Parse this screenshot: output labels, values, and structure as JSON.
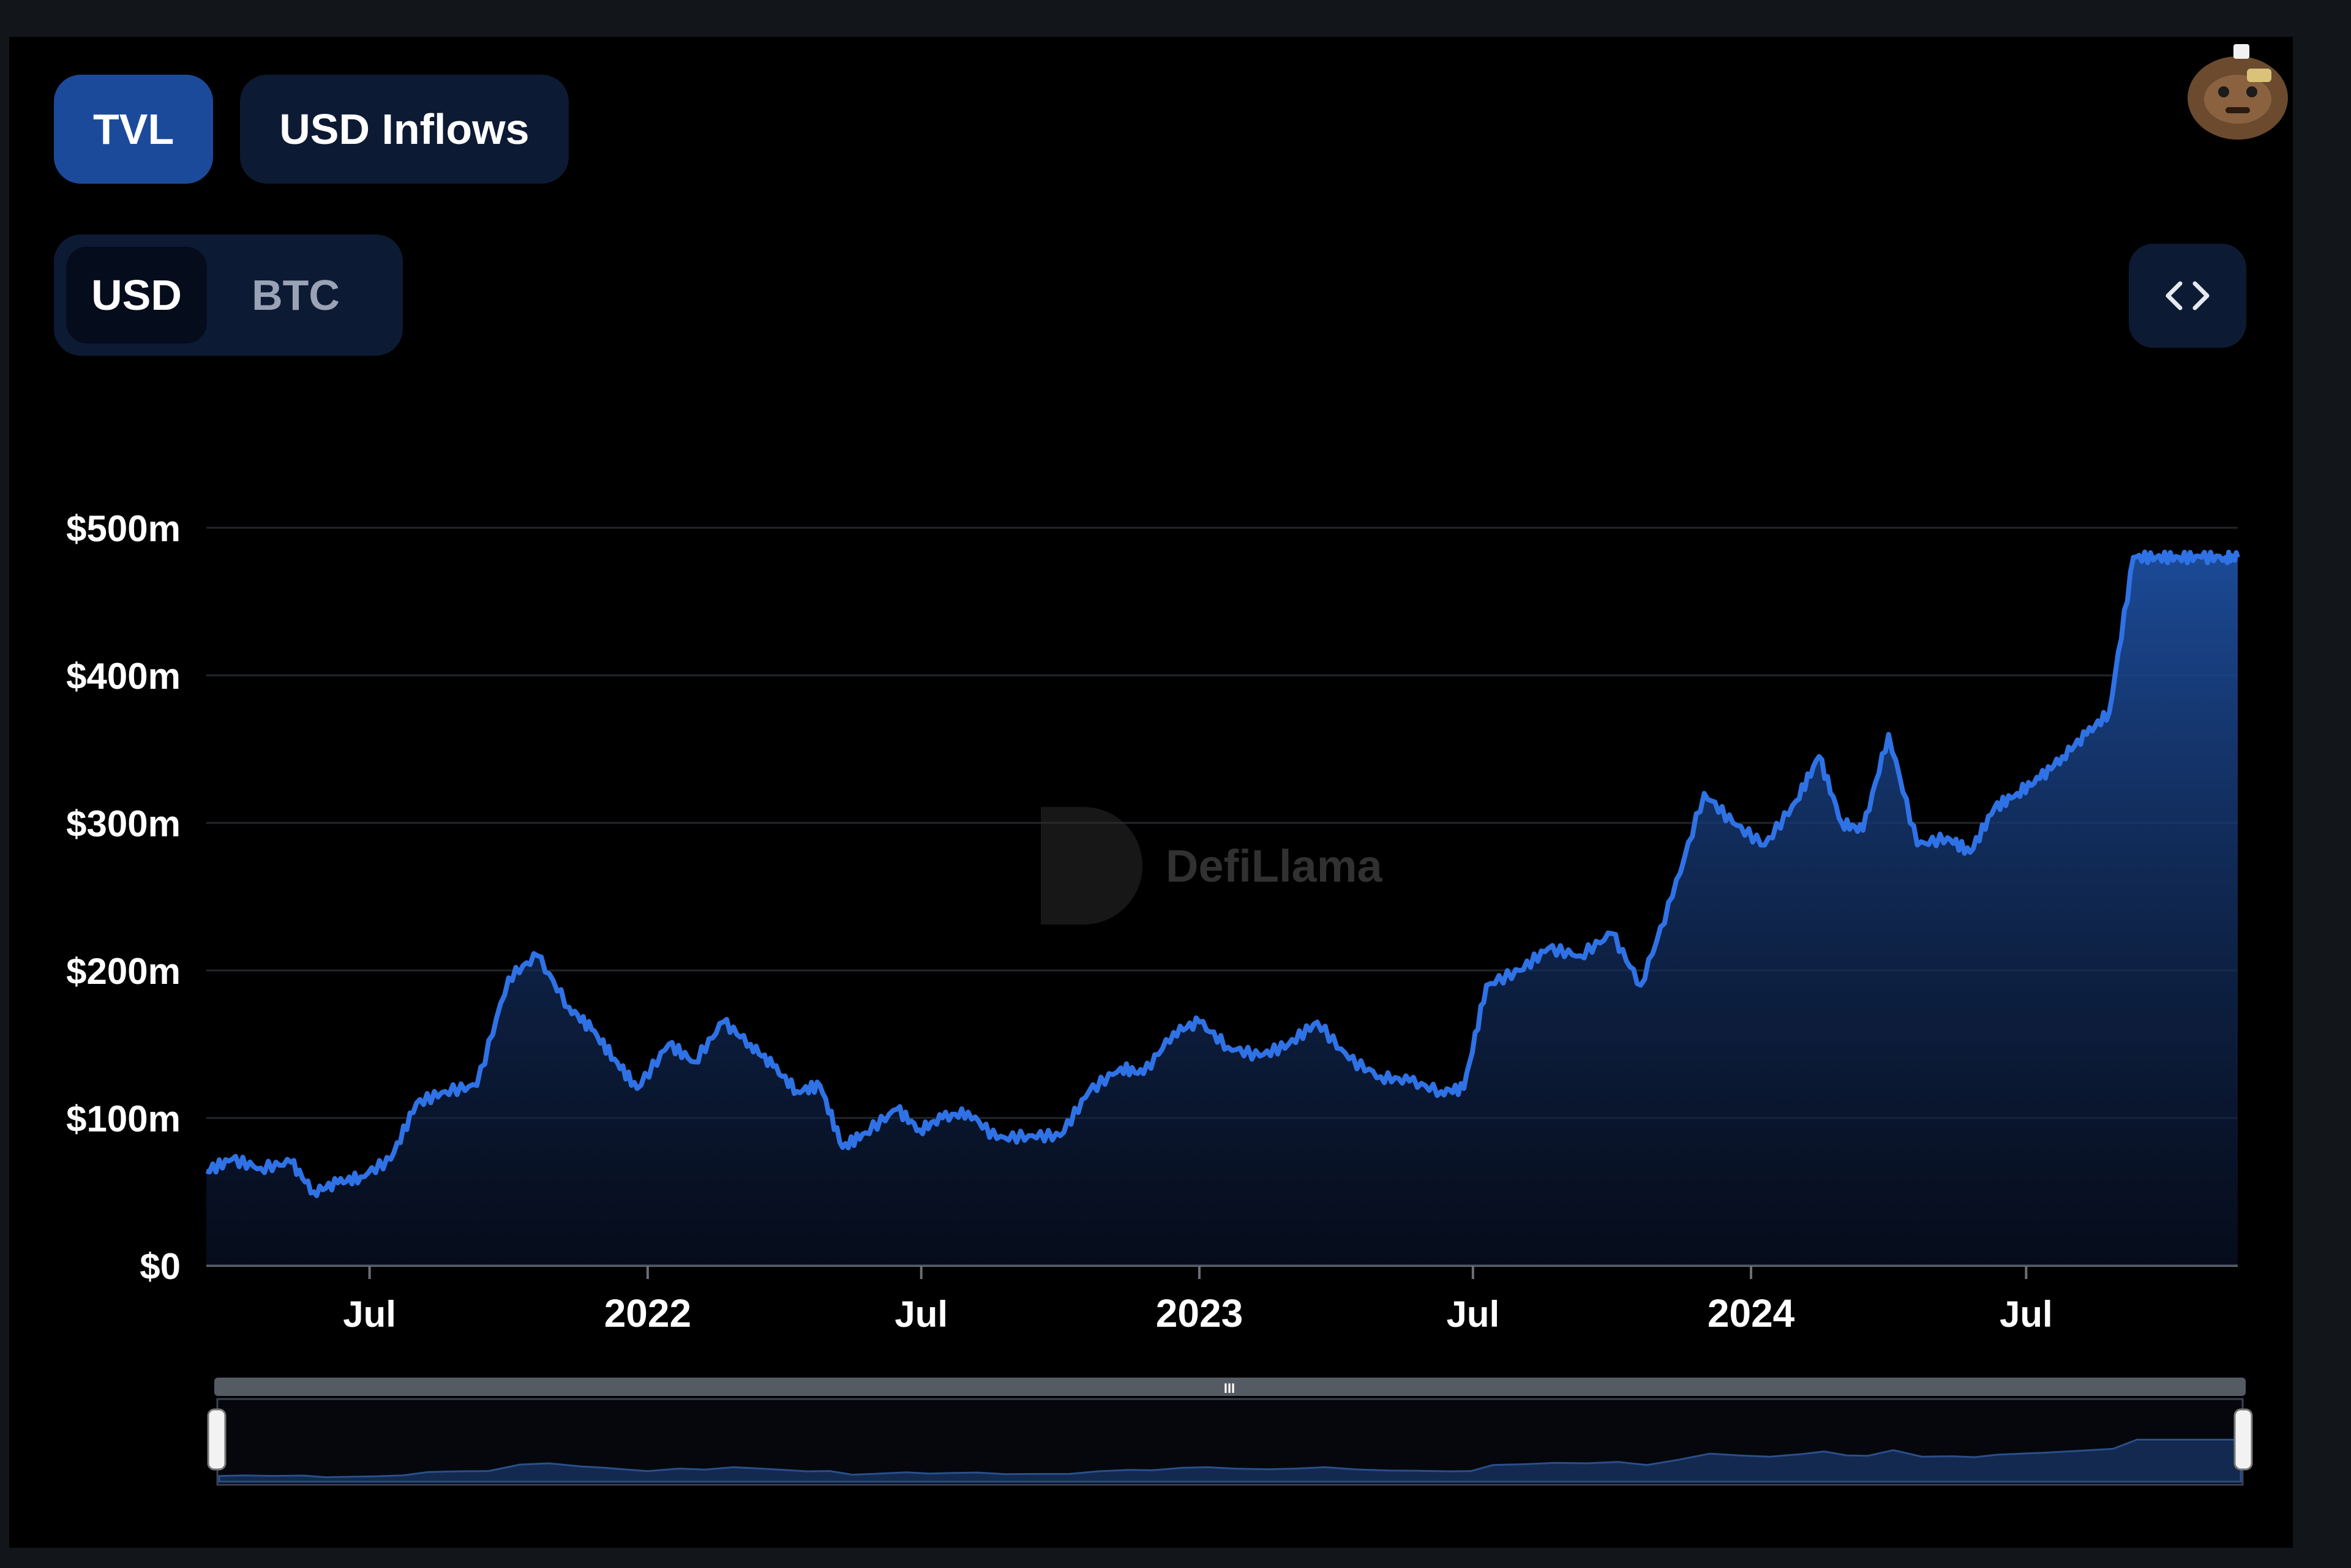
{
  "tabs": [
    {
      "label": "TVL",
      "active": true
    },
    {
      "label": "USD Inflows",
      "active": false
    }
  ],
  "denomination": {
    "options": [
      "USD",
      "BTC"
    ],
    "selected": "USD"
  },
  "icons": {
    "embed": "code-brackets-icon",
    "avatar": "llama-avatar-icon"
  },
  "watermark": "DefiLlama",
  "colors": {
    "line": "#2f72e6",
    "accent": "#1c4a9b",
    "background": "#000000"
  },
  "chart_data": {
    "type": "area",
    "title": "",
    "xlabel": "",
    "ylabel": "",
    "y_ticks": [
      "$0",
      "$100m",
      "$200m",
      "$300m",
      "$400m",
      "$500m"
    ],
    "ylim": [
      0,
      500
    ],
    "y_unit": "$m",
    "x_ticks": [
      {
        "label": "Jul",
        "date": "2021-07-01",
        "bold": false
      },
      {
        "label": "2022",
        "date": "2022-01-01",
        "bold": true
      },
      {
        "label": "Jul",
        "date": "2022-07-01",
        "bold": false
      },
      {
        "label": "2023",
        "date": "2023-01-01",
        "bold": true
      },
      {
        "label": "Jul",
        "date": "2023-07-01",
        "bold": false
      },
      {
        "label": "2024",
        "date": "2024-01-01",
        "bold": true
      },
      {
        "label": "Jul",
        "date": "2024-07-01",
        "bold": false
      }
    ],
    "grid": true,
    "legend": "none",
    "series": [
      {
        "x": [
          "2021-03-15",
          "2021-04-01",
          "2021-04-20",
          "2021-05-10",
          "2021-05-25",
          "2021-06-10",
          "2021-06-25",
          "2021-07-15",
          "2021-08-01",
          "2021-08-20",
          "2021-09-10",
          "2021-10-01",
          "2021-10-20",
          "2021-11-10",
          "2021-11-25",
          "2021-12-10",
          "2021-12-25",
          "2022-01-15",
          "2022-02-01",
          "2022-02-20",
          "2022-03-10",
          "2022-03-25",
          "2022-04-10",
          "2022-04-25",
          "2022-05-10",
          "2022-05-25",
          "2022-06-15",
          "2022-06-30",
          "2022-07-15",
          "2022-08-01",
          "2022-08-20",
          "2022-09-10",
          "2022-10-01",
          "2022-10-20",
          "2022-11-10",
          "2022-11-25",
          "2022-12-15",
          "2023-01-01",
          "2023-01-20",
          "2023-02-10",
          "2023-03-01",
          "2023-03-20",
          "2023-04-10",
          "2023-05-01",
          "2023-05-20",
          "2023-06-10",
          "2023-06-25",
          "2023-07-10",
          "2023-08-01",
          "2023-08-20",
          "2023-09-10",
          "2023-10-01",
          "2023-10-20",
          "2023-11-10",
          "2023-12-01",
          "2023-12-20",
          "2024-01-10",
          "2024-01-31",
          "2024-02-15",
          "2024-03-01",
          "2024-03-15",
          "2024-04-01",
          "2024-04-20",
          "2024-05-10",
          "2024-05-25",
          "2024-06-10",
          "2024-06-25",
          "2024-07-10",
          "2024-07-25",
          "2024-08-10",
          "2024-08-25",
          "2024-09-10",
          "2024-09-25",
          "2024-10-10",
          "2024-10-25",
          "2024-11-10",
          "2024-11-18"
        ],
        "values": [
          64,
          72,
          66,
          70,
          50,
          56,
          60,
          72,
          110,
          118,
          122,
          195,
          210,
          175,
          160,
          140,
          120,
          150,
          138,
          165,
          150,
          135,
          118,
          122,
          80,
          90,
          106,
          92,
          100,
          104,
          86,
          88,
          88,
          118,
          134,
          130,
          158,
          165,
          148,
          142,
          150,
          165,
          140,
          128,
          125,
          118,
          120,
          190,
          200,
          215,
          210,
          225,
          190,
          250,
          320,
          300,
          285,
          315,
          345,
          300,
          295,
          360,
          285,
          290,
          280,
          310,
          320,
          330,
          345,
          360,
          375,
          480,
          480,
          480,
          480,
          480,
          480
        ]
      }
    ]
  },
  "brush": {
    "handle_glyph": "III"
  }
}
